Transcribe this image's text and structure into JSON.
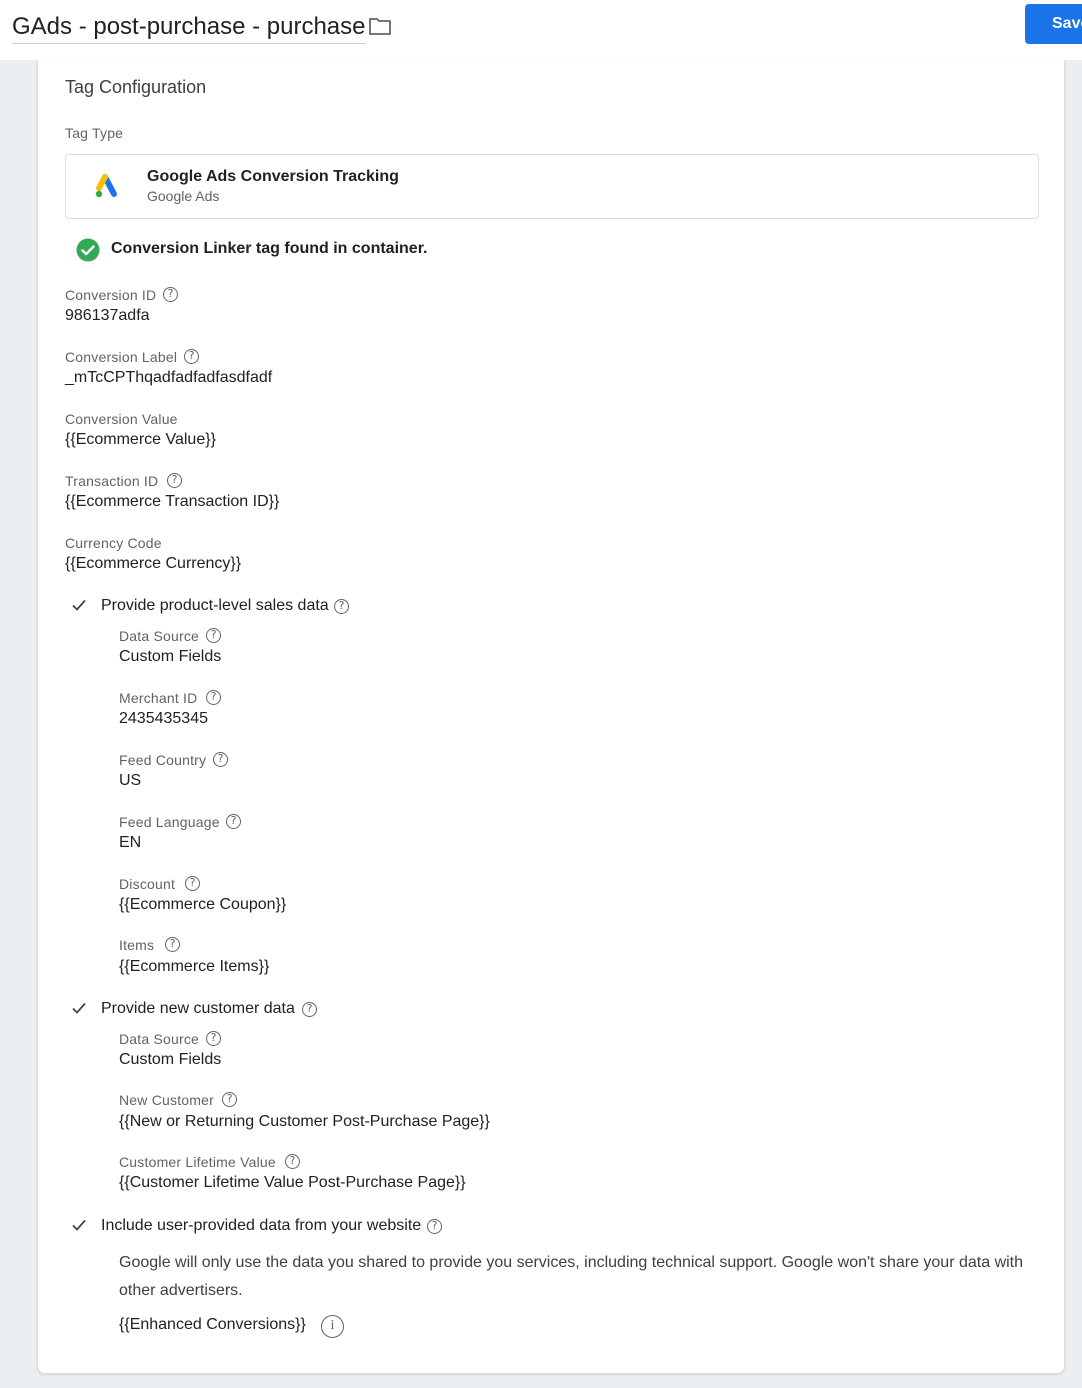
{
  "header": {
    "title": "GAds - post-purchase - purchase",
    "save_label": "Save"
  },
  "config": {
    "section_title": "Tag Configuration",
    "tag_type_label": "Tag Type",
    "tag_type_name": "Google Ads Conversion Tracking",
    "tag_type_vendor": "Google Ads",
    "linker_status": "Conversion Linker tag found in container.",
    "conversion_id_label": "Conversion ID",
    "conversion_id": "986137adfa",
    "conversion_label_label": "Conversion Label",
    "conversion_label": "_mTcCPThqadfadfadfasdfadf",
    "conversion_value_label": "Conversion Value",
    "conversion_value": "{{Ecommerce Value}}",
    "transaction_id_label": "Transaction ID",
    "transaction_id": "{{Ecommerce Transaction ID}}",
    "currency_code_label": "Currency Code",
    "currency_code": "{{Ecommerce Currency}}"
  },
  "product_data": {
    "checkbox_label": "Provide product-level sales data",
    "data_source_label": "Data Source",
    "data_source": "Custom Fields",
    "merchant_id_label": "Merchant ID",
    "merchant_id": "2435435345",
    "feed_country_label": "Feed Country",
    "feed_country": "US",
    "feed_language_label": "Feed Language",
    "feed_language": "EN",
    "discount_label": "Discount",
    "discount": "{{Ecommerce Coupon}}",
    "items_label": "Items",
    "items": "{{Ecommerce Items}}"
  },
  "customer_data": {
    "checkbox_label": "Provide new customer data",
    "data_source_label": "Data Source",
    "data_source": "Custom Fields",
    "new_customer_label": "New Customer",
    "new_customer": "{{New or Returning Customer Post-Purchase Page}}",
    "clv_label": "Customer Lifetime Value",
    "clv": "{{Customer Lifetime Value Post-Purchase Page}}"
  },
  "user_data": {
    "checkbox_label": "Include user-provided data from your website",
    "notice": "Google will only use the data you shared to provide you services, including technical support. Google won't share your data with other advertisers.",
    "variable": "{{Enhanced Conversions}}"
  },
  "icons": {
    "help": "help-circle-icon",
    "check": "check-icon",
    "success": "check-circle-icon",
    "info": "info-icon",
    "folder": "folder-icon",
    "logo": "google-ads-logo"
  },
  "colors": {
    "primary": "#1a73e8",
    "success": "#34a853"
  }
}
